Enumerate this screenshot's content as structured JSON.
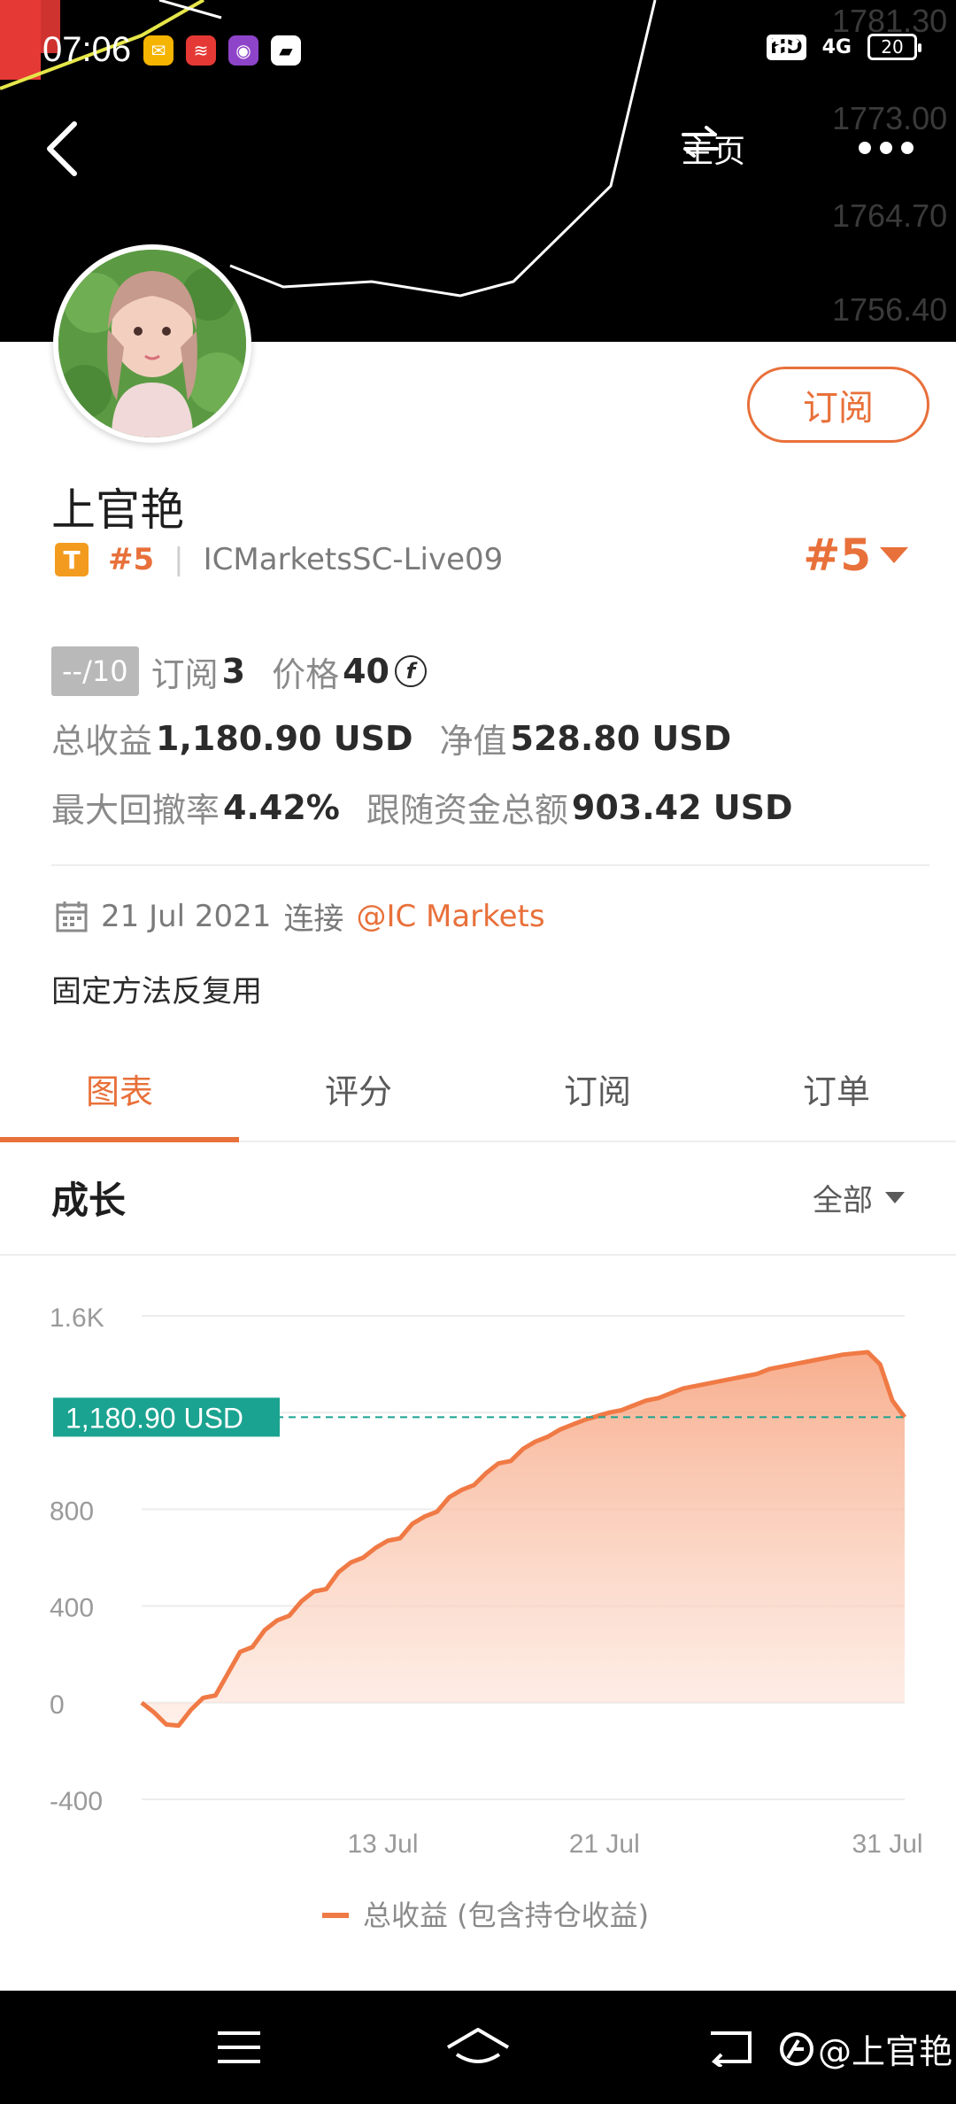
{
  "status_bar": {
    "time": "07:06",
    "network": "4G",
    "hd": "HD",
    "battery": "20"
  },
  "cover": {
    "price_ticks": [
      "1781.30",
      "1773.00",
      "1764.70",
      "1756.40"
    ]
  },
  "header": {
    "home_label": "主页"
  },
  "profile": {
    "name": "上官艳",
    "badge_letter": "T",
    "rank_small": "#5",
    "account": "ICMarketsSC-Live09",
    "rank_big": "#5",
    "subscribe_label": "订阅"
  },
  "stats": {
    "score": "--/10",
    "subscriptions_label": "订阅",
    "subscriptions_value": "3",
    "price_label": "价格",
    "price_value": "40",
    "price_coin": "f",
    "total_profit_label": "总收益",
    "total_profit_value": "1,180.90 USD",
    "net_value_label": "净值",
    "net_value_value": "528.80 USD",
    "max_drawdown_label": "最大回撤率",
    "max_drawdown_value": "4.42%",
    "follow_funds_label": "跟随资金总额",
    "follow_funds_value": "903.42 USD"
  },
  "connection": {
    "date": "21 Jul 2021",
    "connect_word": "连接",
    "broker": "@IC Markets"
  },
  "description": "固定方法反复用",
  "tabs": [
    {
      "label": "图表",
      "active": true
    },
    {
      "label": "评分",
      "active": false
    },
    {
      "label": "订阅",
      "active": false
    },
    {
      "label": "订单",
      "active": false
    }
  ],
  "growth": {
    "title": "成长",
    "range": "全部"
  },
  "chart_data": {
    "type": "area",
    "ylim": [
      -400,
      1600
    ],
    "yticks": [
      "1.6K",
      "800",
      "400",
      "0",
      "-400"
    ],
    "xticks": [
      "13 Jul",
      "21 Jul",
      "31 Jul"
    ],
    "current_value_label": "1,180.90 USD",
    "current_value": 1180.9,
    "legend": "总收益 (包含持仓收益)",
    "color": "#f07a45",
    "series": [
      {
        "name": "总收益 (包含持仓收益)",
        "x": [
          0,
          0.5,
          1,
          1.5,
          2,
          2.5,
          3,
          3.5,
          4,
          4.5,
          5,
          5.5,
          6,
          6.5,
          7,
          7.5,
          8,
          8.5,
          9,
          9.5,
          10,
          10.5,
          11,
          11.5,
          12,
          12.5,
          13,
          13.5,
          14,
          14.5,
          15,
          15.5,
          16,
          16.5,
          17,
          17.5,
          18,
          18.5,
          19,
          19.5,
          20,
          20.5,
          21,
          21.5,
          22,
          22.5,
          23,
          23.5,
          24,
          24.5,
          25,
          25.5,
          26,
          26.5,
          27,
          27.5,
          28,
          28.5,
          29,
          29.5,
          30,
          30.5,
          31
        ],
        "values": [
          0,
          -40,
          -90,
          -95,
          -30,
          20,
          30,
          120,
          210,
          230,
          300,
          340,
          360,
          420,
          460,
          470,
          540,
          580,
          600,
          640,
          670,
          680,
          740,
          770,
          790,
          850,
          880,
          900,
          950,
          990,
          1000,
          1050,
          1080,
          1100,
          1130,
          1150,
          1170,
          1185,
          1200,
          1210,
          1230,
          1250,
          1260,
          1280,
          1300,
          1310,
          1320,
          1330,
          1340,
          1350,
          1360,
          1380,
          1390,
          1400,
          1410,
          1420,
          1430,
          1440,
          1445,
          1450,
          1400,
          1250,
          1180.9
        ]
      }
    ]
  },
  "navbar": {
    "watermark": "@上官艳"
  }
}
